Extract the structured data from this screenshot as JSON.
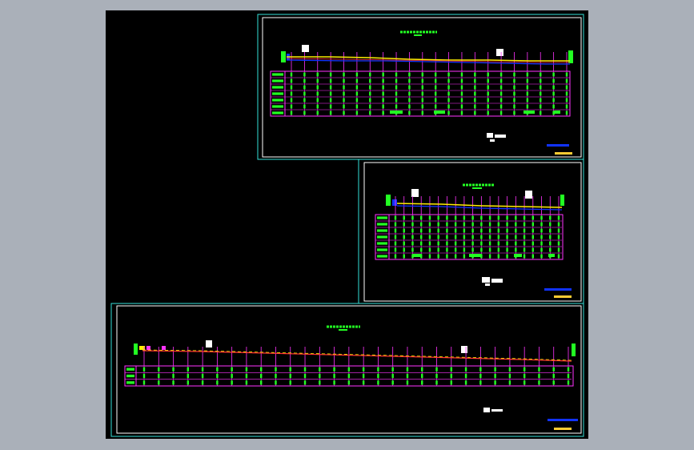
{
  "colors": {
    "background": "#aab0b9",
    "canvas": "#000000",
    "frame": "#35e0d8",
    "sheet_border": "#ffffff",
    "grid": "#ff33ff",
    "label": "#22ff22",
    "design_line": "#ffee00",
    "ground_line": "#1133ff",
    "accent_red": "#ff3333",
    "title_block": "#ffcc33"
  },
  "sheets": [
    {
      "id": "sheet-1",
      "stations": 22,
      "grid_rows": 7,
      "has_ground_line": true
    },
    {
      "id": "sheet-2",
      "stations": 20,
      "grid_rows": 7,
      "has_ground_line": true
    },
    {
      "id": "sheet-3",
      "stations": 30,
      "grid_rows": 3,
      "has_ground_line": false
    }
  ]
}
